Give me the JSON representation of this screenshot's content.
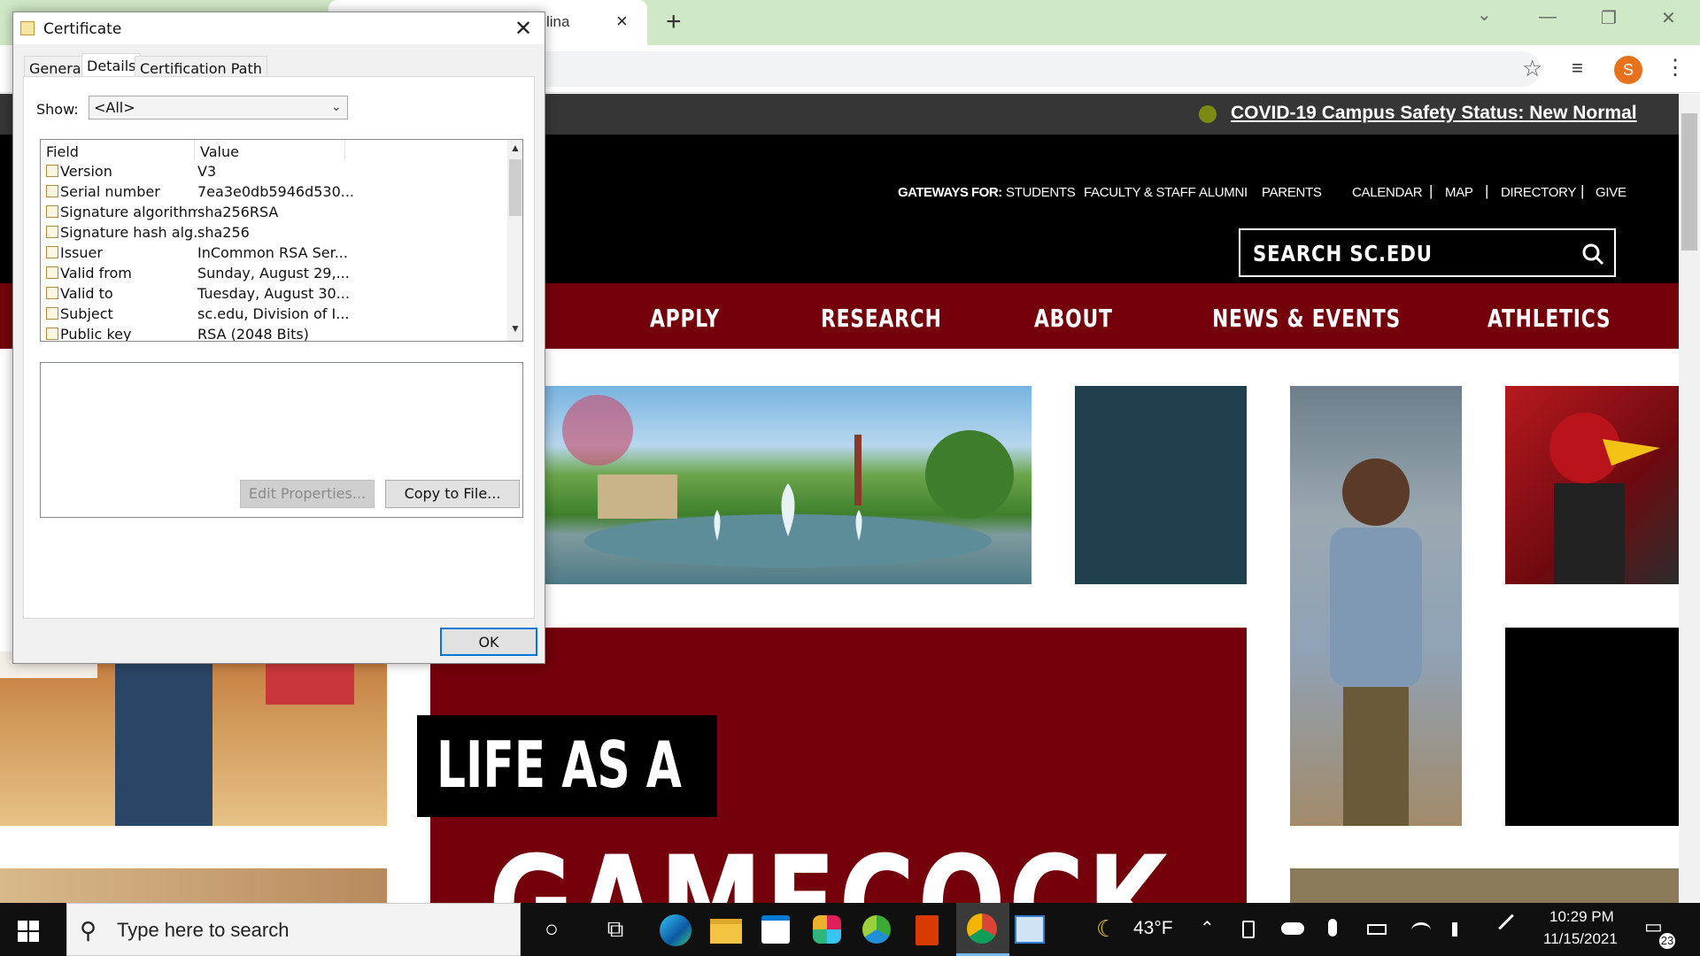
{
  "browser": {
    "tab_title": "lina",
    "tab_close": "×",
    "new_tab": "+",
    "window_minimize": "—",
    "window_restore": "❐",
    "window_close": "✕",
    "tab_search": "⌄",
    "star": "☆",
    "media": "≡",
    "profile_initial": "S",
    "menu": "⋮"
  },
  "site": {
    "alert": "COVID-19 Campus Safety Status: New Normal",
    "alert_color": "#7a8a13",
    "gateways_label": "GATEWAYS FOR:",
    "gateways": [
      "STUDENTS",
      "FACULTY & STAFF",
      "ALUMNI",
      "PARENTS"
    ],
    "utility_links": [
      "CALENDAR",
      "MAP",
      "DIRECTORY",
      "GIVE"
    ],
    "separator": "|",
    "search_label": "SEARCH SC.EDU",
    "nav": [
      "APPLY",
      "RESEARCH",
      "ABOUT",
      "NEWS & EVENTS",
      "ATHLETICS"
    ],
    "hero_line1": "LIFE AS A",
    "hero_line2": "GAMECOCK",
    "brand_color": "#73000a",
    "teal_color": "#1f3f4e"
  },
  "dialog": {
    "title": "Certificate",
    "close": "✕",
    "tabs": [
      "General",
      "Details",
      "Certification Path"
    ],
    "show_label": "Show:",
    "show_value": "<All>",
    "show_chevron": "⌄",
    "col_field": "Field",
    "col_value": "Value",
    "rows": [
      {
        "field": "Version",
        "value": "V3"
      },
      {
        "field": "Serial number",
        "value": "7ea3e0db5946d530..."
      },
      {
        "field": "Signature algorithm",
        "value": "sha256RSA"
      },
      {
        "field": "Signature hash alg...",
        "value": "sha256"
      },
      {
        "field": "Issuer",
        "value": "InCommon RSA Ser..."
      },
      {
        "field": "Valid from",
        "value": "Sunday, August 29,..."
      },
      {
        "field": "Valid to",
        "value": "Tuesday, August 30..."
      },
      {
        "field": "Subject",
        "value": "sc.edu, Division of I..."
      },
      {
        "field": "Public key",
        "value": "RSA (2048 Bits)"
      }
    ],
    "scroll_up": "▲",
    "scroll_down": "▼",
    "edit_properties": "Edit Properties...",
    "copy_to_file": "Copy to File...",
    "ok": "OK"
  },
  "taskbar": {
    "search_placeholder": "Type here to search",
    "search_icon": "⚲",
    "cortana": "○",
    "task_view": "⧉",
    "weather_temp": "43°F",
    "moon": "☾",
    "chevron_up": "⌃",
    "time": "10:29 PM",
    "date": "11/15/2021",
    "notifications": "23",
    "notif_icon": "▭"
  }
}
